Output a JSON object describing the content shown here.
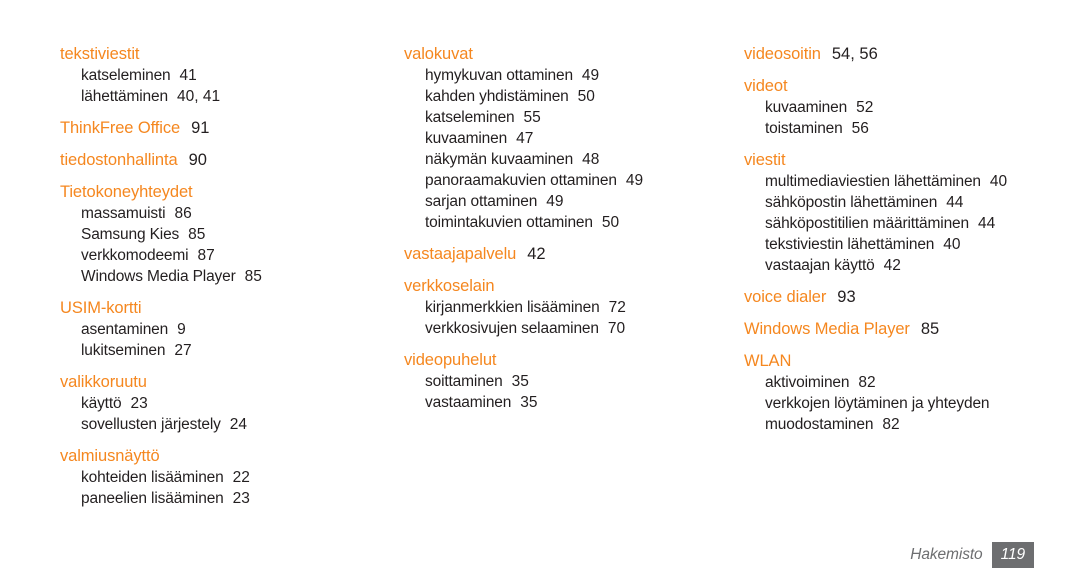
{
  "document": {
    "type": "index-page",
    "language": "fi",
    "accent_color": "#f5871f",
    "text_color": "#231f20",
    "footer_color": "#6d6e70",
    "background": "#ffffff"
  },
  "footer": {
    "label": "Hakemisto",
    "page_number": "119"
  },
  "columns": [
    {
      "id": "column-1",
      "groups": [
        {
          "heading": "tekstiviestit",
          "pages": "",
          "entries": [
            {
              "text": "katseleminen",
              "pages": "41"
            },
            {
              "text": "lähettäminen",
              "pages": "40, 41"
            }
          ]
        },
        {
          "heading": "ThinkFree Office",
          "pages": "91",
          "entries": []
        },
        {
          "heading": "tiedostonhallinta",
          "pages": "90",
          "entries": []
        },
        {
          "heading": "Tietokoneyhteydet",
          "pages": "",
          "entries": [
            {
              "text": "massamuisti",
              "pages": "86"
            },
            {
              "text": "Samsung Kies",
              "pages": "85"
            },
            {
              "text": "verkkomodeemi",
              "pages": "87"
            },
            {
              "text": "Windows Media Player",
              "pages": "85"
            }
          ]
        },
        {
          "heading": "USIM-kortti",
          "pages": "",
          "entries": [
            {
              "text": "asentaminen",
              "pages": "9"
            },
            {
              "text": "lukitseminen",
              "pages": "27"
            }
          ]
        },
        {
          "heading": "valikkoruutu",
          "pages": "",
          "entries": [
            {
              "text": "käyttö",
              "pages": "23"
            },
            {
              "text": "sovellusten järjestely",
              "pages": "24"
            }
          ]
        },
        {
          "heading": "valmiusnäyttö",
          "pages": "",
          "entries": [
            {
              "text": "kohteiden lisääminen",
              "pages": "22"
            },
            {
              "text": "paneelien lisääminen",
              "pages": "23"
            }
          ]
        }
      ]
    },
    {
      "id": "column-2",
      "groups": [
        {
          "heading": "valokuvat",
          "pages": "",
          "entries": [
            {
              "text": "hymykuvan ottaminen",
              "pages": "49"
            },
            {
              "text": "kahden yhdistäminen",
              "pages": "50"
            },
            {
              "text": "katseleminen",
              "pages": "55"
            },
            {
              "text": "kuvaaminen",
              "pages": "47"
            },
            {
              "text": "näkymän kuvaaminen",
              "pages": "48"
            },
            {
              "text": "panoraamakuvien ottaminen",
              "pages": "49"
            },
            {
              "text": "sarjan ottaminen",
              "pages": "49"
            },
            {
              "text": "toimintakuvien ottaminen",
              "pages": "50"
            }
          ]
        },
        {
          "heading": "vastaajapalvelu",
          "pages": "42",
          "entries": []
        },
        {
          "heading": "verkkoselain",
          "pages": "",
          "entries": [
            {
              "text": "kirjanmerkkien lisääminen",
              "pages": "72"
            },
            {
              "text": "verkkosivujen selaaminen",
              "pages": "70"
            }
          ]
        },
        {
          "heading": "videopuhelut",
          "pages": "",
          "entries": [
            {
              "text": "soittaminen",
              "pages": "35"
            },
            {
              "text": "vastaaminen",
              "pages": "35"
            }
          ]
        }
      ]
    },
    {
      "id": "column-3",
      "groups": [
        {
          "heading": "videosoitin",
          "pages": "54, 56",
          "entries": []
        },
        {
          "heading": "videot",
          "pages": "",
          "entries": [
            {
              "text": "kuvaaminen",
              "pages": "52"
            },
            {
              "text": "toistaminen",
              "pages": "56"
            }
          ]
        },
        {
          "heading": "viestit",
          "pages": "",
          "entries": [
            {
              "text": "multimediaviestien lähettäminen",
              "pages": "40",
              "wrap": true
            },
            {
              "text": "sähköpostin lähettäminen",
              "pages": "44"
            },
            {
              "text": "sähköpostitilien määrittäminen",
              "pages": "44"
            },
            {
              "text": "tekstiviestin lähettäminen",
              "pages": "40"
            },
            {
              "text": "vastaajan käyttö",
              "pages": "42"
            }
          ]
        },
        {
          "heading": "voice dialer",
          "pages": "93",
          "entries": []
        },
        {
          "heading": "Windows Media Player",
          "pages": "85",
          "entries": []
        },
        {
          "heading": "WLAN",
          "pages": "",
          "entries": [
            {
              "text": "aktivoiminen",
              "pages": "82"
            },
            {
              "text": "verkkojen löytäminen ja yhteyden muodostaminen",
              "pages": "82",
              "wrap": true
            }
          ]
        }
      ]
    }
  ]
}
